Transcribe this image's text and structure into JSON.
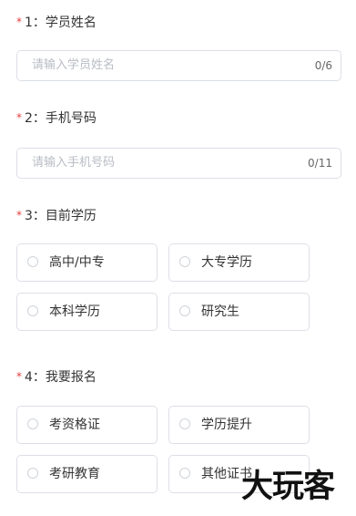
{
  "form": {
    "q1": {
      "required_mark": "*",
      "label": "1：学员姓名",
      "placeholder": "请输入学员姓名",
      "counter": "0/6"
    },
    "q2": {
      "required_mark": "*",
      "label": "2：手机号码",
      "placeholder": "请输入手机号码",
      "counter": "0/11"
    },
    "q3": {
      "required_mark": "*",
      "label": "3：目前学历",
      "options": [
        "高中/中专",
        "大专学历",
        "本科学历",
        "研究生"
      ]
    },
    "q4": {
      "required_mark": "*",
      "label": "4：我要报名",
      "options": [
        "考资格证",
        "学历提升",
        "考研教育",
        "其他证书"
      ]
    }
  },
  "watermark": {
    "text": "大玩客"
  },
  "colors": {
    "required": "#e23b3b",
    "border": "#dcdfe6",
    "placeholder": "#b8bcc4",
    "text": "#333333"
  }
}
